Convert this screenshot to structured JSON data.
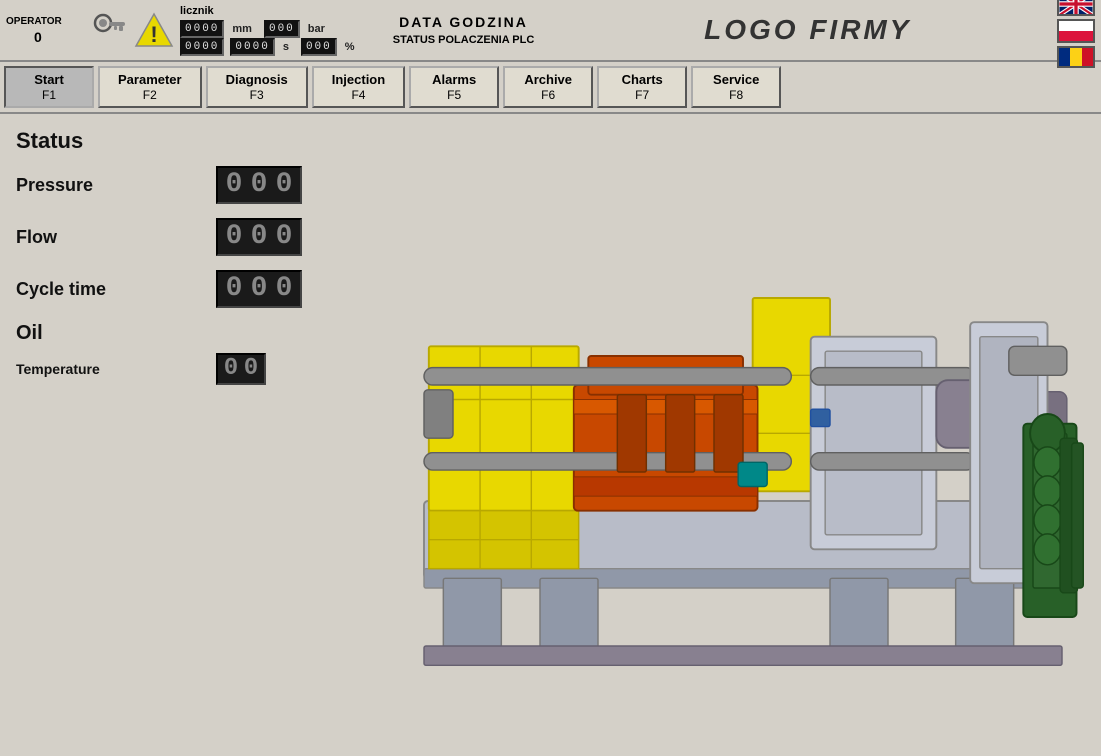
{
  "header": {
    "operator_label": "OPERATOR",
    "operator_value": "0",
    "licznik_label": "licznik",
    "mm_label": "mm",
    "bar_label": "bar",
    "s_label": "s",
    "percent_label": "%",
    "data_godzina": "DATA GODZINA",
    "status_polaczenia": "STATUS POLACZENIA PLC",
    "logo": "LOGO FIRMY"
  },
  "nav": {
    "buttons": [
      {
        "label": "Start",
        "sub": "F1",
        "active": true
      },
      {
        "label": "Parameter",
        "sub": "F2",
        "active": false
      },
      {
        "label": "Diagnosis",
        "sub": "F3",
        "active": false
      },
      {
        "label": "Injection",
        "sub": "F4",
        "active": false
      },
      {
        "label": "Alarms",
        "sub": "F5",
        "active": false
      },
      {
        "label": "Archive",
        "sub": "F6",
        "active": false
      },
      {
        "label": "Charts",
        "sub": "F7",
        "active": false
      },
      {
        "label": "Service",
        "sub": "F8",
        "active": false
      }
    ]
  },
  "status": {
    "title": "Status",
    "pressure_label": "Pressure",
    "flow_label": "Flow",
    "cycle_time_label": "Cycle time",
    "oil_title": "Oil",
    "temperature_label": "Temperature",
    "seg_placeholder": "000",
    "seg_placeholder_sm": "00"
  }
}
